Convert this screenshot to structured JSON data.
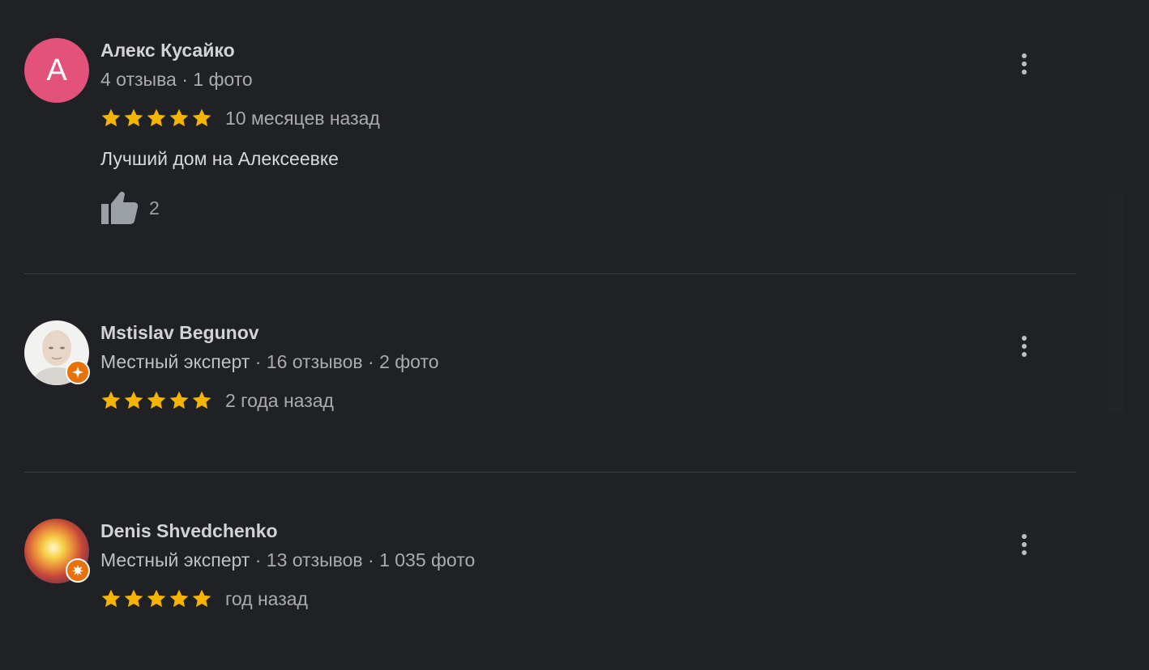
{
  "colors": {
    "background": "#202124",
    "star": "#f4b400",
    "avatar_letter_bg": "#e3527a",
    "badge": "#e8710a"
  },
  "reviews": [
    {
      "avatar_letter": "А",
      "name": "Алекс Кусайко",
      "meta": "4 отзыва · 1 фото",
      "rating": 5,
      "date": "10 месяцев назад",
      "text": "Лучший дом на Алексеевке",
      "likes": "2",
      "like_icon": "thumb-up-icon",
      "menu_icon": "more-vert-icon"
    },
    {
      "avatar": "profile-photo",
      "badge_icon": "local-guide-badge-icon",
      "name": "Mstislav Begunov",
      "expert": "Местный эксперт",
      "meta": " · 16 отзывов · 2 фото",
      "rating": 5,
      "date": "2 года назад",
      "menu_icon": "more-vert-icon"
    },
    {
      "avatar": "profile-photo",
      "badge_icon": "local-guide-badge-icon",
      "name": "Denis Shvedchenko",
      "expert": "Местный эксперт",
      "meta": " · 13 отзывов · 1 035 фото",
      "rating": 5,
      "date": "год назад",
      "menu_icon": "more-vert-icon"
    }
  ]
}
